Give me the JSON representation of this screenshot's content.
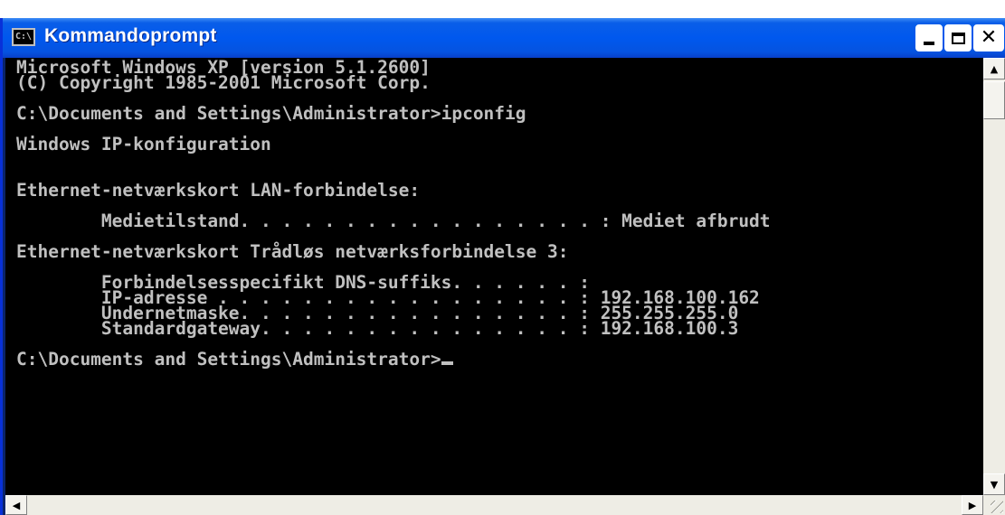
{
  "window": {
    "title": "Kommandoprompt",
    "icon": "console-icon",
    "icon_text": "C:\\"
  },
  "title_buttons": {
    "minimize_icon": "minimize-icon",
    "maximize_icon": "maximize-icon",
    "close_icon": "close-icon",
    "close_glyph": "✕"
  },
  "console": {
    "lines": [
      "Microsoft Windows XP [version 5.1.2600]",
      "(C) Copyright 1985-2001 Microsoft Corp.",
      "",
      "C:\\Documents and Settings\\Administrator>ipconfig",
      "",
      "Windows IP-konfiguration",
      "",
      "",
      "Ethernet-netværkskort LAN-forbindelse:",
      "",
      "        Medietilstand. . . . . . . . . . . . . . . . . : Mediet afbrudt",
      "",
      "Ethernet-netværkskort Trådløs netværksforbindelse 3:",
      "",
      "        Forbindelsesspecifikt DNS-suffiks. . . . . . :",
      "        IP-adresse . . . . . . . . . . . . . . . . . : 192.168.100.162",
      "        Undernetmaske. . . . . . . . . . . . . . . . : 255.255.255.0",
      "        Standardgateway. . . . . . . . . . . . . . . : 192.168.100.3",
      "",
      "C:\\Documents and Settings\\Administrator>"
    ],
    "colors": {
      "background": "#000000",
      "text": "#c0c0c0"
    }
  },
  "scrollbars": {
    "up_arrow": "▲",
    "down_arrow": "▼",
    "left_arrow": "◀",
    "right_arrow": "▶"
  },
  "colors": {
    "titlebar": "#0058ee",
    "title_text": "#ffffff"
  }
}
